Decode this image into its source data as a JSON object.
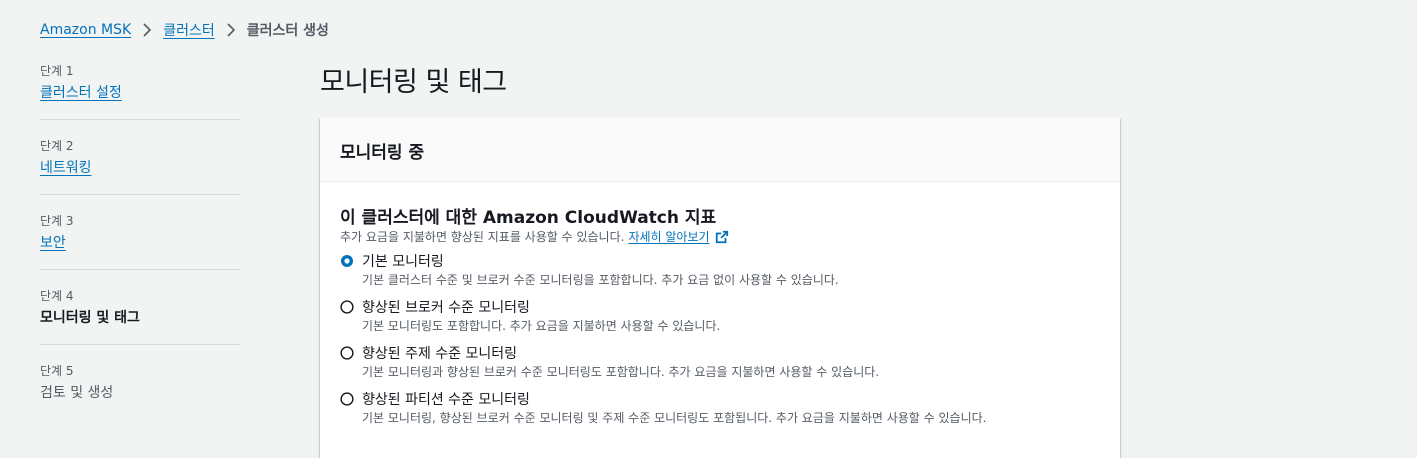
{
  "breadcrumb": {
    "items": [
      "Amazon MSK",
      "클러스터"
    ],
    "current": "클러스터 생성"
  },
  "steps": [
    {
      "num": "단계 1",
      "label": "클러스터 설정",
      "state": "link"
    },
    {
      "num": "단계 2",
      "label": "네트워킹",
      "state": "link"
    },
    {
      "num": "단계 3",
      "label": "보안",
      "state": "link"
    },
    {
      "num": "단계 4",
      "label": "모니터링 및 태그",
      "state": "current"
    },
    {
      "num": "단계 5",
      "label": "검토 및 생성",
      "state": "disabled"
    }
  ],
  "page_title": "모니터링 및 태그",
  "panel": {
    "title": "모니터링 중",
    "section_title": "이 클러스터에 대한 Amazon CloudWatch 지표",
    "section_desc": "추가 요금을 지불하면 향상된 지표를 사용할 수 있습니다.",
    "learn_more": "자세히 알아보기",
    "options": [
      {
        "label": "기본 모니터링",
        "desc": "기본 클러스터 수준 및 브로커 수준 모니터링을 포함합니다. 추가 요금 없이 사용할 수 있습니다.",
        "selected": true
      },
      {
        "label": "향상된 브로커 수준 모니터링",
        "desc": "기본 모니터링도 포함합니다. 추가 요금을 지불하면 사용할 수 있습니다.",
        "selected": false
      },
      {
        "label": "향상된 주제 수준 모니터링",
        "desc": "기본 모니터링과 향상된 브로커 수준 모니터링도 포함합니다. 추가 요금을 지불하면 사용할 수 있습니다.",
        "selected": false
      },
      {
        "label": "향상된 파티션 수준 모니터링",
        "desc": "기본 모니터링, 향상된 브로커 수준 모니터링 및 주제 수준 모니터링도 포함됩니다. 추가 요금을 지불하면 사용할 수 있습니다.",
        "selected": false
      }
    ]
  },
  "colors": {
    "link": "#0073bb",
    "background": "#f2f3f3",
    "text": "#16191f",
    "secondary_text": "#545b64",
    "radio_selected": "#0073bb",
    "divider": "#d5dbdb"
  },
  "icons": {
    "breadcrumb_separator": "chevron-right-icon",
    "external_link": "external-link-icon",
    "radio_selected": "radio-selected-icon",
    "radio_unselected": "radio-unselected-icon"
  }
}
